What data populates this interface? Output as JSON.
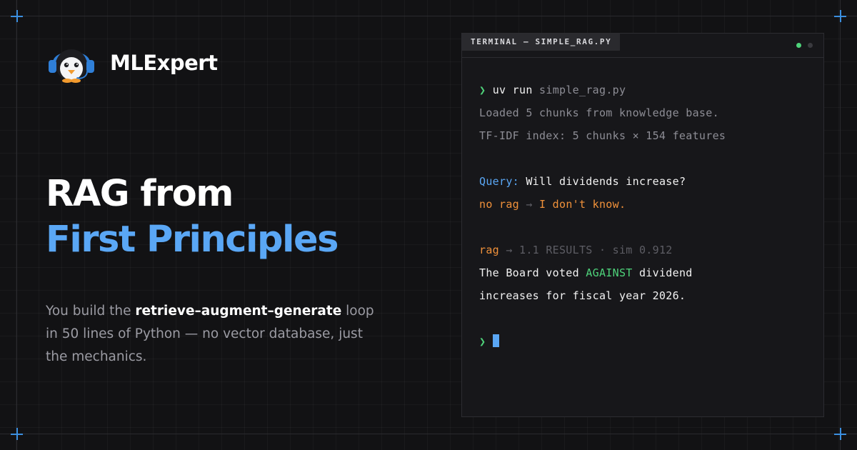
{
  "brand": {
    "name": "MLExpert",
    "logo_icon": "penguin-headphones-icon"
  },
  "headline": {
    "line1": "RAG from",
    "line2": "First Principles"
  },
  "description": {
    "pre": "You build the ",
    "bold": "retrieve–augment–generate",
    "post": " loop in 50 lines of Python — no vector database, just the mechanics."
  },
  "terminal": {
    "tab_title": "TERMINAL — SIMPLE_RAG.PY",
    "prompt_symbol": "❯",
    "command_keyword": "uv run",
    "command_arg": "simple_rag.py",
    "output_line1": "Loaded 5 chunks from knowledge base.",
    "output_line2": "TF-IDF index: 5 chunks × 154 features",
    "query_label": "Query:",
    "query_text": " Will dividends increase?",
    "norag_label": "no rag",
    "norag_arrow": " → ",
    "norag_answer": "I don't know.",
    "rag_label": "rag",
    "rag_meta": " → 1.1 RESULTS · sim 0.912",
    "answer_pre": "The Board voted ",
    "answer_highlight": "AGAINST",
    "answer_post": " dividend",
    "answer_line2": "increases for fiscal year 2026."
  },
  "colors": {
    "accent": "#5aa7f5",
    "success": "#4ed37a",
    "warning": "#f0913a",
    "background": "#121214"
  }
}
